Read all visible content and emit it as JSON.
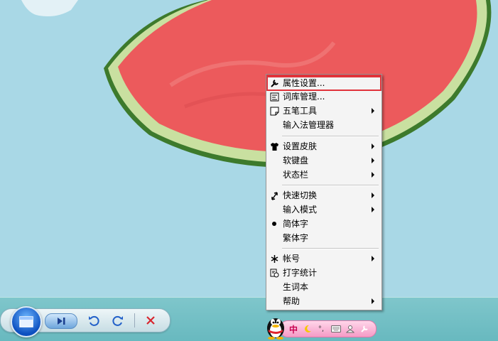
{
  "menu": {
    "items": [
      {
        "label": "属性设置...",
        "icon": "wrench-icon",
        "submenu": false,
        "highlighted": true
      },
      {
        "label": "词库管理...",
        "icon": "dictionary-icon",
        "submenu": false
      },
      {
        "label": "五笔工具",
        "icon": "note-icon",
        "submenu": true
      },
      {
        "label": "输入法管理器",
        "icon": "",
        "submenu": false
      },
      {
        "label": "设置皮肤",
        "icon": "tshirt-icon",
        "submenu": true
      },
      {
        "label": "软键盘",
        "icon": "",
        "submenu": true
      },
      {
        "label": "状态栏",
        "icon": "",
        "submenu": true
      },
      {
        "label": "快速切换",
        "icon": "switch-icon",
        "submenu": true
      },
      {
        "label": "输入模式",
        "icon": "",
        "submenu": true
      },
      {
        "label": "简体字",
        "icon": "bullet-icon",
        "submenu": false,
        "selected": true
      },
      {
        "label": "繁体字",
        "icon": "",
        "submenu": false
      },
      {
        "label": "帐号",
        "icon": "account-icon",
        "submenu": true
      },
      {
        "label": "打字统计",
        "icon": "stats-icon",
        "submenu": false
      },
      {
        "label": "生词本",
        "icon": "",
        "submenu": false
      },
      {
        "label": "帮助",
        "icon": "",
        "submenu": true
      }
    ]
  },
  "ime_bar": {
    "mode_label": "中",
    "punct_label": "°,",
    "icons": [
      "moon-icon",
      "punctuation-icon",
      "keyboard-icon",
      "user-icon",
      "wrench-icon"
    ]
  },
  "player": {
    "icons": [
      "window-icon",
      "next-track-icon",
      "undo-icon",
      "redo-icon",
      "close-icon"
    ]
  },
  "colors": {
    "accent": "#e0323a",
    "menu_bg": "#f4f4f4",
    "desktop": "#a9d8e6",
    "taskbar": "#74c0c5"
  }
}
